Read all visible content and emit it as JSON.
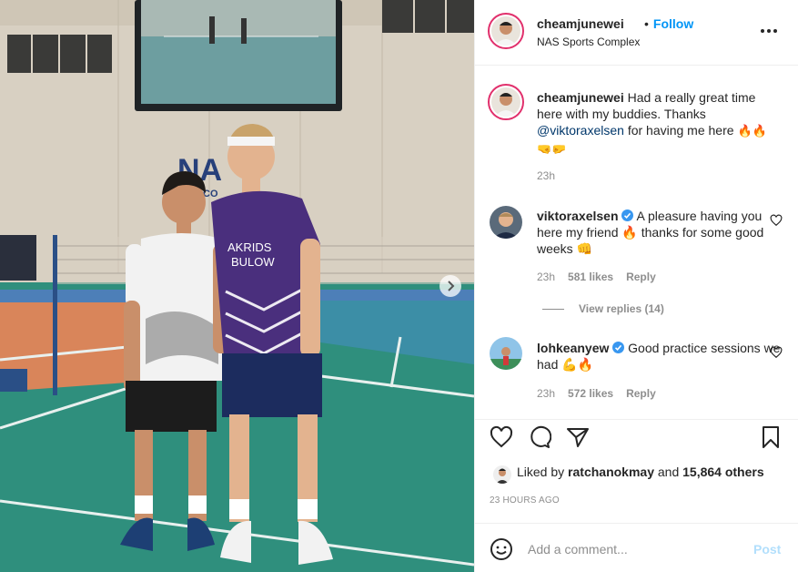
{
  "post": {
    "location": "NAS Sports Complex",
    "photo_description_icon": "photo-icon",
    "next_icon": "chevron-right-icon"
  },
  "header": {
    "username": "cheamjunewei",
    "separator": "•",
    "follow_label": "Follow",
    "location": "NAS Sports Complex"
  },
  "caption": {
    "username": "cheamjunewei",
    "text_1": "Had a really great time here with my buddies. Thanks",
    "mention": "@viktoraxelsen",
    "text_2": "for having me here",
    "emojis": "🔥🔥 🤜🤛",
    "time": "23h"
  },
  "comments": [
    {
      "username": "viktoraxelsen",
      "verified": true,
      "text": "A pleasure having you here my friend 🔥 thanks for some good weeks 👊",
      "time": "23h",
      "likes": "581 likes",
      "reply": "Reply",
      "view_replies": "View replies (14)"
    },
    {
      "username": "lohkeanyew",
      "verified": true,
      "text": "Good practice sessions we had 💪🔥",
      "time": "23h",
      "likes": "572 likes",
      "reply": "Reply"
    }
  ],
  "likes": {
    "prefix": "Liked by",
    "user": "ratchanokmay",
    "middle": "and",
    "others": "15,864 others"
  },
  "timestamp": "23 HOURS AGO",
  "add_comment": {
    "placeholder": "Add a comment...",
    "post_label": "Post"
  },
  "colors": {
    "follow": "#0095f6",
    "mention": "#00376b",
    "verified": "#3897f0",
    "post_disabled": "#b2dffc",
    "fire": "#f56a1a"
  }
}
